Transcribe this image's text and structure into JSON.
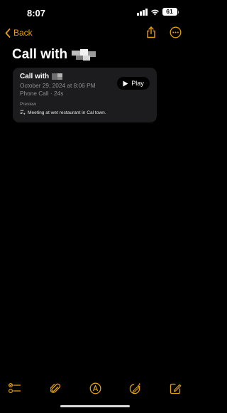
{
  "status_bar": {
    "time": "8:07",
    "battery": "61"
  },
  "nav": {
    "back_label": "Back",
    "icons": [
      "chevron-left-icon",
      "share-icon",
      "more-icon"
    ]
  },
  "note": {
    "title": "Call with"
  },
  "call_card": {
    "title": "Call with",
    "date": "October 29, 2024 at 8:06 PM",
    "meta": "Phone Call · 24s",
    "play_label": "Play",
    "preview_label": "Preview",
    "preview_text": "Meeting at wet restaurant in Cal town."
  },
  "toolbar": {
    "icons": [
      "checklist-icon",
      "attachment-icon",
      "markup-icon",
      "compose-ai-icon",
      "new-note-icon"
    ]
  },
  "colors": {
    "accent": "#e5a00d",
    "background": "#000000",
    "card": "#1c1c1e",
    "secondary_text": "#8e8e93"
  }
}
